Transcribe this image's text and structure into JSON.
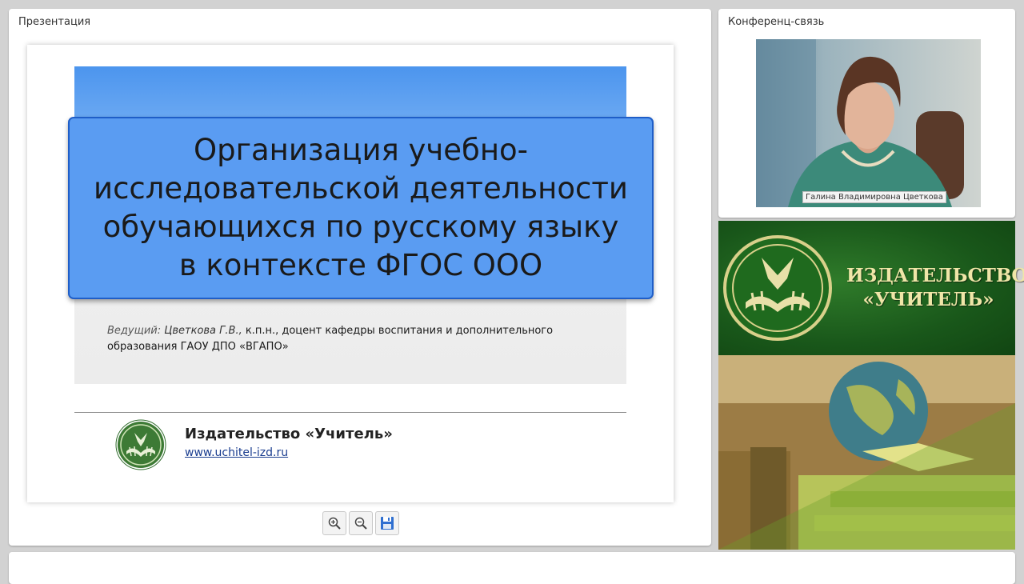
{
  "presentation_panel": {
    "title": "Презентация",
    "slide": {
      "title": "Организация учебно-\nисследовательской деятельности\nобучающихся по русскому языку\nв контексте ФГОС ООО",
      "presenter_label": "Ведущий:",
      "presenter_name": "Цветкова Г.В.,",
      "presenter_details_line1": " к.п.н., доцент кафедры воспитания и дополнительного",
      "presenter_details_line2": "образования ГАОУ ДПО «ВГАПО»",
      "publisher_name": "Издательство «Учитель»",
      "publisher_url": "www.uchitel-izd.ru"
    },
    "toolbar": {
      "zoom_in_icon": "zoom-in-icon",
      "zoom_out_icon": "zoom-out-icon",
      "save_icon": "floppy-disk-icon"
    }
  },
  "conference_panel": {
    "title": "Конференц-связь",
    "participant_name": "Галина Владимировна Цветкова"
  },
  "banner": {
    "text": "ИЗДАТЕЛЬСТВО\n«УЧИТЕЛЬ»"
  },
  "colors": {
    "slide_title_fill": "#5a9cf2",
    "slide_title_border": "#1f5ec8",
    "banner_green": "#19571a",
    "banner_text": "#f0e6a8"
  }
}
